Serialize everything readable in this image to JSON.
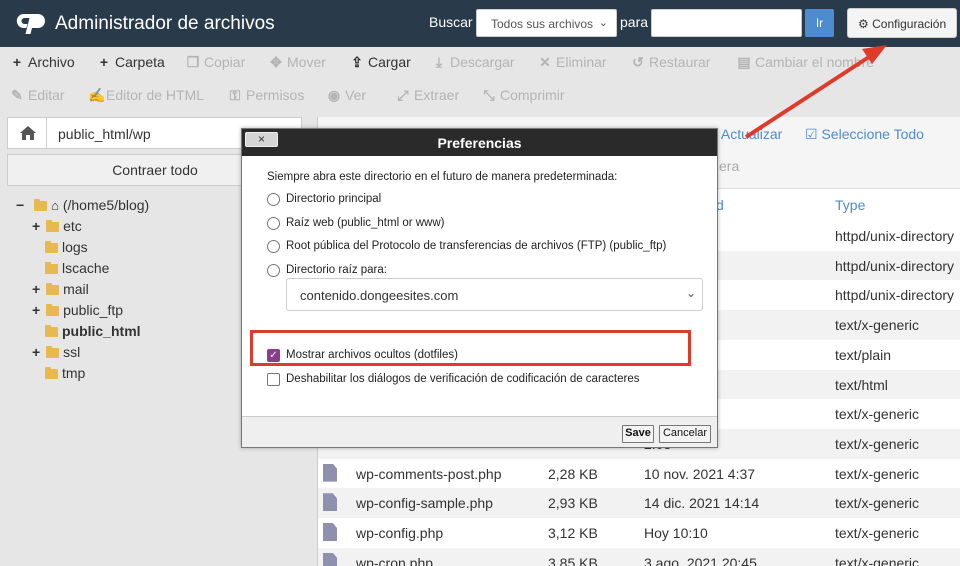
{
  "header": {
    "title": "Administrador de archivos",
    "search_label": "Buscar",
    "search_scope": "Todos sus archivos",
    "for_label": "para",
    "search_placeholder": "",
    "go_label": "Ir",
    "settings_label": "Configuración"
  },
  "toolbar": {
    "row1": [
      {
        "label": "Archivo",
        "icon": "plus-icon",
        "enabled": true
      },
      {
        "label": "Carpeta",
        "icon": "plus-icon",
        "enabled": true
      },
      {
        "label": "Copiar",
        "icon": "copy-icon",
        "enabled": false
      },
      {
        "label": "Mover",
        "icon": "move-icon",
        "enabled": false
      },
      {
        "label": "Cargar",
        "icon": "upload-icon",
        "enabled": true
      },
      {
        "label": "Descargar",
        "icon": "download-icon",
        "enabled": false
      },
      {
        "label": "Eliminar",
        "icon": "delete-icon",
        "enabled": false
      },
      {
        "label": "Restaurar",
        "icon": "restore-icon",
        "enabled": false
      },
      {
        "label": "Cambiar el nombre",
        "icon": "rename-icon",
        "enabled": false
      }
    ],
    "row2": [
      {
        "label": "Editar",
        "icon": "pencil-icon",
        "enabled": false
      },
      {
        "label": "Editor de HTML",
        "icon": "html-editor-icon",
        "enabled": false
      },
      {
        "label": "Permisos",
        "icon": "key-icon",
        "enabled": false
      },
      {
        "label": "Ver",
        "icon": "eye-icon",
        "enabled": false
      },
      {
        "label": "Extraer",
        "icon": "extract-icon",
        "enabled": false
      },
      {
        "label": "Comprimir",
        "icon": "compress-icon",
        "enabled": false
      }
    ]
  },
  "sidebar": {
    "path": "public_html/wp",
    "collapse_label": "Contraer todo",
    "tree": [
      {
        "label": "(/home5/blog)",
        "toggle": "−",
        "root": true
      },
      {
        "label": "etc",
        "toggle": "+"
      },
      {
        "label": "logs",
        "toggle": ""
      },
      {
        "label": "lscache",
        "toggle": ""
      },
      {
        "label": "mail",
        "toggle": "+"
      },
      {
        "label": "public_ftp",
        "toggle": "+"
      },
      {
        "label": "public_html",
        "toggle": "",
        "bold": true
      },
      {
        "label": "ssl",
        "toggle": "+"
      },
      {
        "label": "tmp",
        "toggle": ""
      }
    ]
  },
  "file_panel": {
    "update_label": "Actualizar",
    "select_all_label": "Seleccione Todo",
    "trash_fragment": "era",
    "col_modified_fragment": "d",
    "col_type": "Type",
    "rows": [
      {
        "name": "",
        "size": "",
        "modified": "",
        "type": "httpd/unix-directory"
      },
      {
        "name": "",
        "size": "",
        "modified": "",
        "type": "httpd/unix-directory"
      },
      {
        "name": "",
        "size": "",
        "modified": "",
        "type": "httpd/unix-directory"
      },
      {
        "name": "",
        "size": "",
        "modified": "2:03",
        "type": "text/x-generic"
      },
      {
        "name": "",
        "size": "",
        "modified": "5:45",
        "type": "text/plain"
      },
      {
        "name": "",
        "size": "",
        "modified": "23:08",
        "type": "text/html"
      },
      {
        "name": "",
        "size": "",
        "modified": "7:07",
        "type": "text/x-generic"
      },
      {
        "name": "",
        "size": "",
        "modified": "2:03",
        "type": "text/x-generic"
      },
      {
        "name": "wp-comments-post.php",
        "size": "2,28 KB",
        "modified": "10 nov. 2021 4:37",
        "type": "text/x-generic"
      },
      {
        "name": "wp-config-sample.php",
        "size": "2,93 KB",
        "modified": "14 dic. 2021 14:14",
        "type": "text/x-generic"
      },
      {
        "name": "wp-config.php",
        "size": "3,12 KB",
        "modified": "Hoy 10:10",
        "type": "text/x-generic"
      },
      {
        "name": "wp-cron.php",
        "size": "3,85 KB",
        "modified": "3 ago. 2021 20:45",
        "type": "text/x-generic"
      }
    ]
  },
  "dialog": {
    "close_label": "×",
    "title": "Preferencias",
    "intro": "Siempre abra este directorio en el futuro de manera predeterminada:",
    "options": [
      {
        "label": "Directorio principal"
      },
      {
        "label": "Raíz web (public_html or www)"
      },
      {
        "label": "Root pública del Protocolo de transferencias de archivos (FTP) (public_ftp)"
      },
      {
        "label": "Directorio raíz para:"
      }
    ],
    "domain": "contenido.dongeesites.com",
    "show_hidden_label": "Mostrar archivos ocultos (dotfiles)",
    "show_hidden_checked": true,
    "disable_encoding_label": "Deshabilitar los diálogos de verificación de codificación de caracteres",
    "disable_encoding_checked": false,
    "save_label": "Save",
    "cancel_label": "Cancelar"
  },
  "colors": {
    "header_bg": "#293a4a",
    "accent": "#4e8cd0",
    "highlight": "#e03a2b",
    "checkbox": "#8a3d8c"
  }
}
